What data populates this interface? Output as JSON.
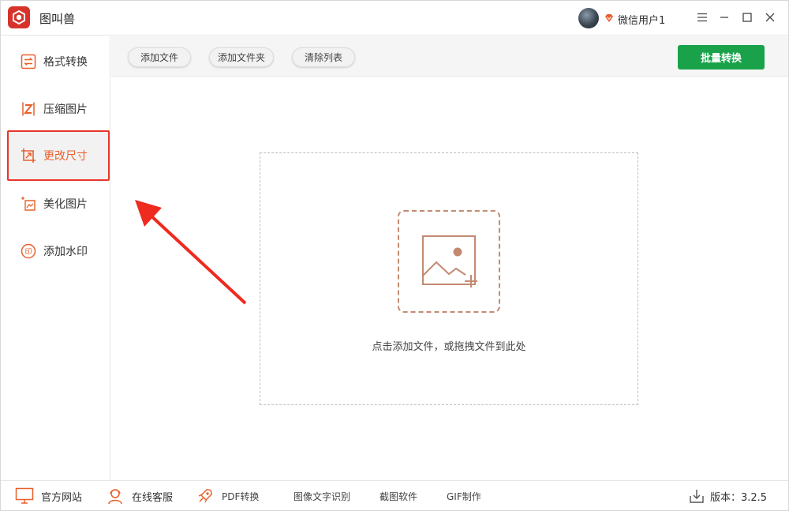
{
  "app": {
    "title": "图叫兽"
  },
  "user": {
    "name": "微信用户1"
  },
  "sidebar": {
    "items": [
      {
        "label": "格式转换",
        "icon": "format-convert-icon"
      },
      {
        "label": "压缩图片",
        "icon": "compress-icon"
      },
      {
        "label": "更改尺寸",
        "icon": "resize-icon",
        "active": true
      },
      {
        "label": "美化图片",
        "icon": "beautify-icon"
      },
      {
        "label": "添加水印",
        "icon": "watermark-icon"
      }
    ]
  },
  "toolbar": {
    "add_file": "添加文件",
    "add_folder": "添加文件夹",
    "clear_list": "清除列表",
    "batch_convert": "批量转换"
  },
  "dropzone": {
    "hint": "点击添加文件，或拖拽文件到此处"
  },
  "footer": {
    "website": "官方网站",
    "support": "在线客服",
    "pdf": "PDF转换",
    "ocr": "图像文字识别",
    "screenshot": "截图软件",
    "gif": "GIF制作",
    "version_label": "版本：3.2.5"
  },
  "colors": {
    "accent": "#e8602c",
    "highlight_border": "#e8362b",
    "primary_green": "#1aa24b",
    "icon_brown": "#c38a72"
  }
}
